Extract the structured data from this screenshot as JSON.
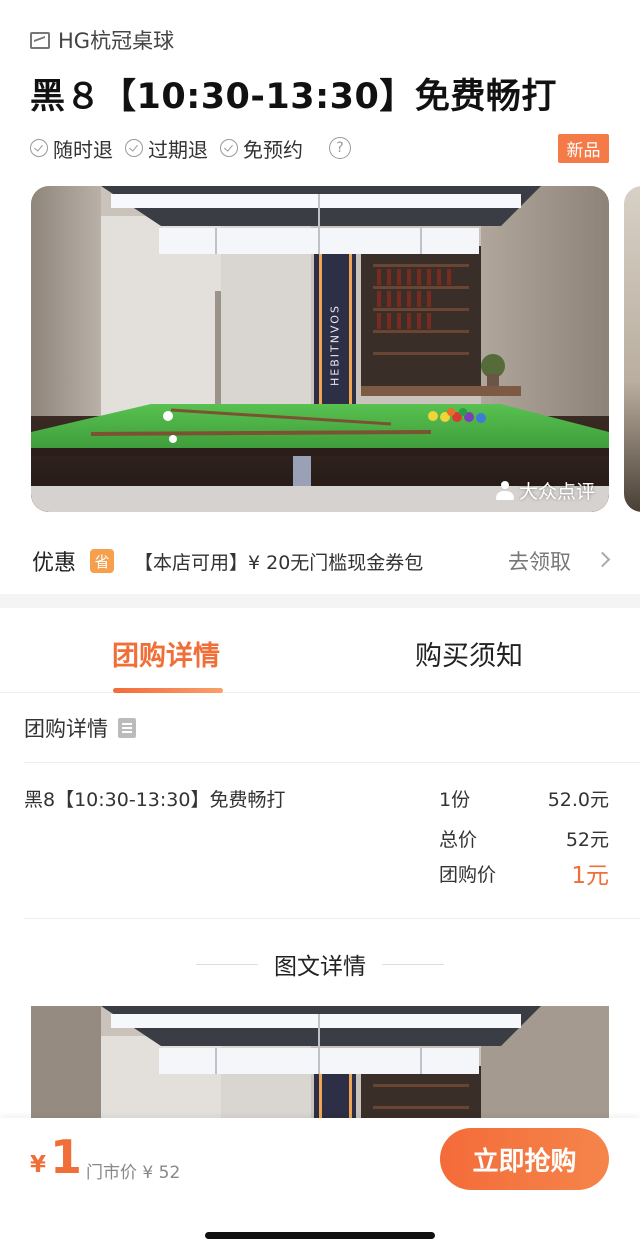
{
  "shop": {
    "name": "HG杭冠桌球"
  },
  "product": {
    "title": "黑８【10:30-13:30】免费畅打"
  },
  "tags": [
    "随时退",
    "过期退",
    "免预约"
  ],
  "badge": "新品",
  "hero": {
    "watermark": "大众点评",
    "wall_sign": "HEBITNVOS"
  },
  "coupon": {
    "label": "优惠",
    "icon_text": "省",
    "text": "【本店可用】¥ 20无门槛现金券包",
    "action": "去领取"
  },
  "tabs": [
    {
      "label": "团购详情",
      "active": true
    },
    {
      "label": "购买须知",
      "active": false
    }
  ],
  "deal": {
    "section_title": "团购详情",
    "item_name": "黑8【10:30-13:30】免费畅打",
    "quantity": "1份",
    "unit_price": "52.0元",
    "total_label": "总价",
    "total_value": "52元",
    "group_label": "团购价",
    "group_value": "1元"
  },
  "detail": {
    "heading": "图文详情"
  },
  "footer": {
    "currency": "¥",
    "price": "1",
    "market_price": "门市价 ¥ 52",
    "buy_label": "立即抢购"
  },
  "colors": {
    "accent": "#f06f38",
    "table_felt": "#4bb04a"
  }
}
